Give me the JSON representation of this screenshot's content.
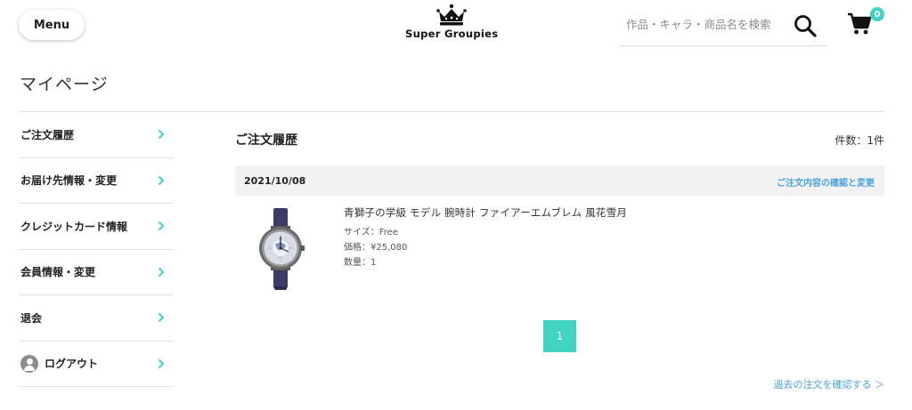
{
  "header": {
    "menu_label": "Menu",
    "logo_text": "Super Groupies",
    "search_placeholder": "作品・キャラ・商品名を検索",
    "cart_count": "0",
    "accent_color": "#3fd3c0"
  },
  "page": {
    "title": "マイページ"
  },
  "sidebar": {
    "items": [
      {
        "label": "ご注文履歴"
      },
      {
        "label": "お届け先情報・変更"
      },
      {
        "label": "クレジットカード情報"
      },
      {
        "label": "会員情報・変更"
      },
      {
        "label": "退会"
      },
      {
        "label": "ログアウト",
        "icon": "user-icon"
      }
    ]
  },
  "orders": {
    "section_title": "ご注文履歴",
    "count_text": "件数：1件",
    "list": [
      {
        "date": "2021/10/08",
        "detail_link": "ご注文内容の確認と変更",
        "product_name": "青獅子の学級 モデル 腕時計 ファイアーエムブレム 風花雪月",
        "size": "サイズ：Free",
        "price": "価格：¥25,080",
        "quantity": "数量：1"
      }
    ],
    "current_page": "1",
    "past_orders_link": "過去の注文を確認する ＞",
    "link_color": "#4aa3e0"
  }
}
